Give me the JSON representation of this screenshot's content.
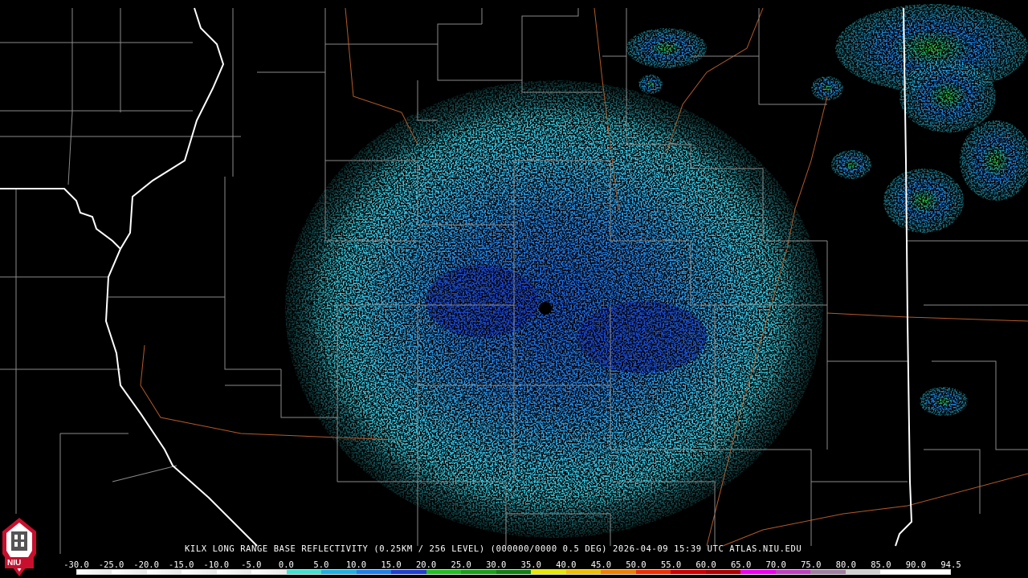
{
  "map": {
    "radar_site": "KILX",
    "product": "LONG RANGE BASE REFLECTIVITY",
    "resolution": "0.25KM / 256 LEVEL",
    "elevation": "000000/0000 0.5 DEG",
    "timestamp": "2026-04-09 15:39 UTC",
    "source": "ATLAS.NIU.EDU",
    "caption": "KILX LONG RANGE BASE REFLECTIVITY (0.25KM / 256 LEVEL) (000000/0000 0.5 DEG) 2026-04-09 15:39 UTC  ATLAS.NIU.EDU"
  },
  "logo": {
    "text": "NIU",
    "color_red": "#c8102e"
  },
  "colorbar": {
    "labels": [
      "-30.0",
      "-25.0",
      "-20.0",
      "-15.0",
      "-10.0",
      "-5.0",
      "0.0",
      "5.0",
      "10.0",
      "15.0",
      "20.0",
      "25.0",
      "30.0",
      "35.0",
      "40.0",
      "45.0",
      "50.0",
      "55.0",
      "60.0",
      "65.0",
      "70.0",
      "75.0",
      "80.0",
      "85.0",
      "90.0",
      "94.5"
    ],
    "colors": [
      "#ffffff",
      "#ffffff",
      "#ffffff",
      "#ffffff",
      "#ffffff",
      "#ffffff",
      "#40e0d0",
      "#1fb0e0",
      "#1e7fe8",
      "#2040d0",
      "#20c020",
      "#18a018",
      "#108010",
      "#e8e800",
      "#f0c000",
      "#f08000",
      "#f03000",
      "#d00000",
      "#b00000",
      "#f000f0",
      "#c040c0",
      "#a080a0",
      "#d0d0d0",
      "#ffffff",
      "#ffffff"
    ]
  },
  "colors": {
    "county_lines": "#ffffff",
    "state_lines": "#ffffff",
    "rivers": "#b45a28",
    "background": "#000000"
  }
}
